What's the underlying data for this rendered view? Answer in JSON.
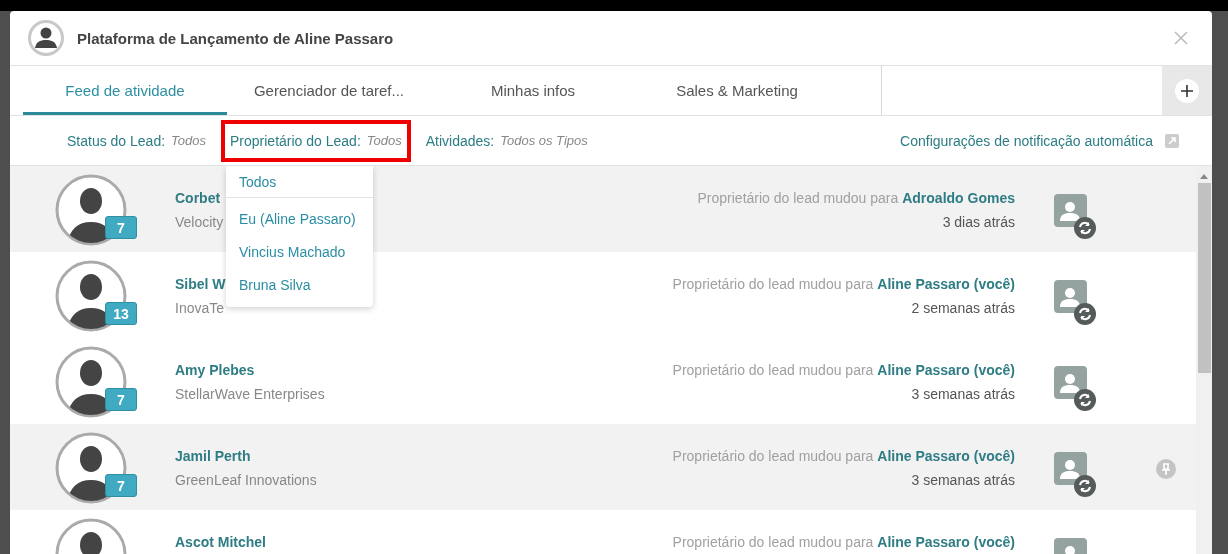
{
  "window": {
    "title": "Plataforma de Lançamento de Aline Passaro"
  },
  "tabs": [
    {
      "label": "Feed de atividade",
      "selected": true
    },
    {
      "label": "Gerenciador de taref...",
      "selected": false
    },
    {
      "label": "Minhas infos",
      "selected": false
    },
    {
      "label": "Sales & Marketing",
      "selected": false
    }
  ],
  "filters": [
    {
      "label": "Status do Lead:",
      "value": "Todos",
      "highlighted": false
    },
    {
      "label": "Proprietário do Lead:",
      "value": "Todos",
      "highlighted": true
    },
    {
      "label": "Atividades:",
      "value": "Todos os Tipos",
      "highlighted": false
    }
  ],
  "settings_link": "Configurações de notificação automática",
  "dropdown": {
    "groups": [
      [
        "Todos"
      ],
      [
        "Eu (Aline Passaro)",
        "Vincius Machado",
        "Bruna Silva"
      ]
    ]
  },
  "feed": [
    {
      "name": "Corbet",
      "company": "Velocity",
      "count": "7",
      "message": "Proprietário do lead mudou para",
      "owner": "Adroaldo Gomes",
      "time": "3 dias atrás",
      "highlighted": true,
      "pin": false
    },
    {
      "name": "Sibel W",
      "company": "InovaTe",
      "count": "13",
      "message": "Proprietário do lead mudou para",
      "owner": "Aline Passaro (você)",
      "time": "2 semanas atrás",
      "highlighted": false,
      "pin": false
    },
    {
      "name": "Amy Plebes",
      "company": "StellarWave Enterprises",
      "count": "7",
      "message": "Proprietário do lead mudou para",
      "owner": "Aline Passaro (você)",
      "time": "3 semanas atrás",
      "highlighted": false,
      "pin": false
    },
    {
      "name": "Jamil Perth",
      "company": "GreenLeaf Innovations",
      "count": "7",
      "message": "Proprietário do lead mudou para",
      "owner": "Aline Passaro (você)",
      "time": "3 semanas atrás",
      "highlighted": true,
      "pin": true
    },
    {
      "name": "Ascot Mitchel",
      "message": "Proprietário do lead mudou para",
      "owner": "Aline Passaro (você)",
      "highlighted": false,
      "pin": false
    }
  ]
}
